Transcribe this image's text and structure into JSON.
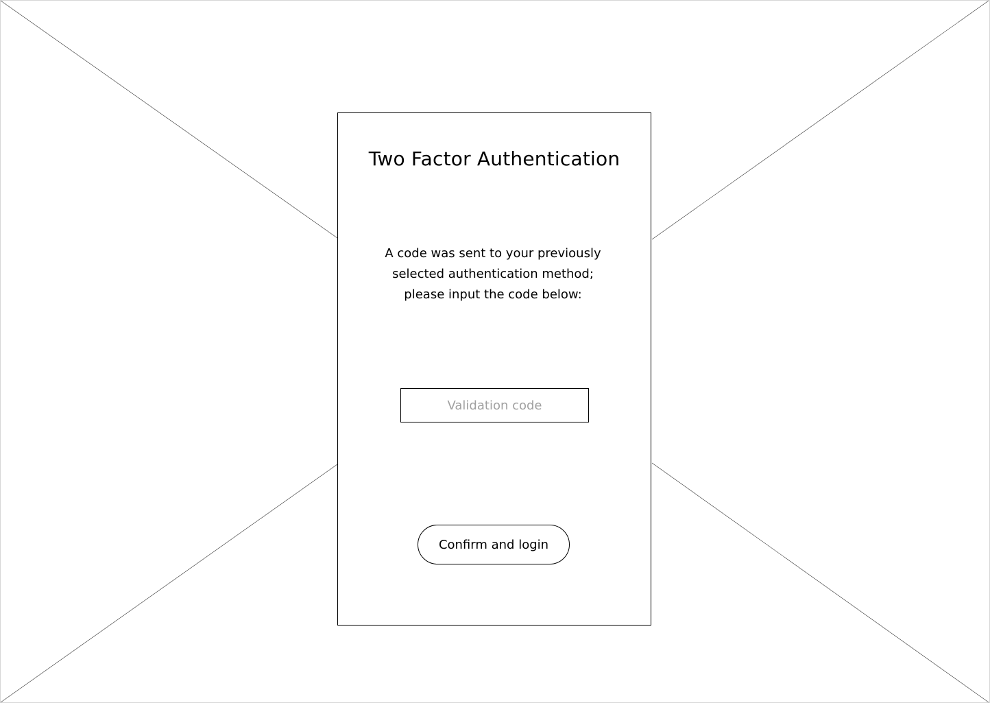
{
  "auth": {
    "title": "Two Factor Authentication",
    "message": "A code was sent to your previously selected authentication method; please input the code below:",
    "code_input": {
      "value": "",
      "placeholder": "Validation code"
    },
    "confirm_label": "Confirm and login"
  }
}
